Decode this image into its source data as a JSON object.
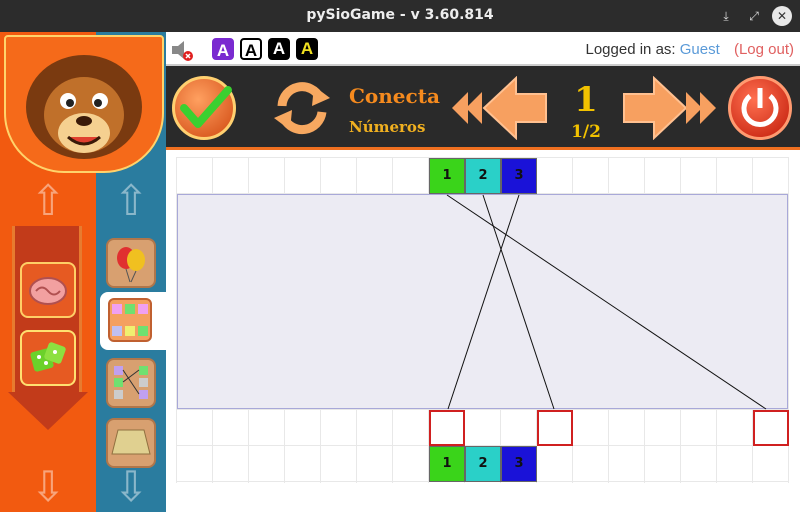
{
  "window": {
    "title": "pySioGame - v 3.60.814",
    "controls": [
      "minimize-icon",
      "maximize-icon",
      "close-icon"
    ]
  },
  "infobar": {
    "badges": [
      "A",
      "A",
      "A",
      "A"
    ],
    "logged_prefix": "Logged in as:",
    "user": "Guest",
    "logout": "(Log out)"
  },
  "toolbar": {
    "game_title": "Conecta",
    "game_subtitle": "Números",
    "level": "1",
    "progress": "1/2"
  },
  "game": {
    "top_numbers": [
      {
        "label": "1",
        "color": "#3ad41a"
      },
      {
        "label": "2",
        "color": "#2ad0c8"
      },
      {
        "label": "3",
        "color": "#1a12d8"
      }
    ],
    "bottom_numbers": [
      {
        "label": "1",
        "color": "#3ad41a"
      },
      {
        "label": "2",
        "color": "#2ad0c8"
      },
      {
        "label": "3",
        "color": "#1a12d8"
      }
    ]
  },
  "colors": {
    "accent_orange": "#f25a10",
    "sidebar_blue": "#2a7c9f",
    "toolbar_bg": "#2a2a2a",
    "level_yellow": "#f2c200"
  }
}
